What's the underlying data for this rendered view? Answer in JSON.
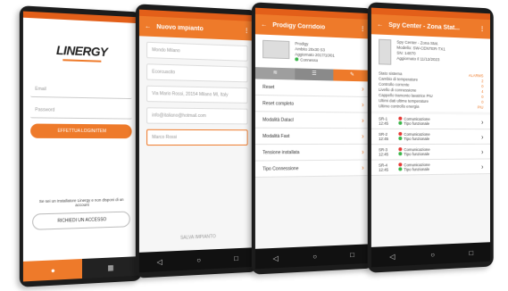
{
  "colors": {
    "accent": "#ee7a2a",
    "status_dark": "#e35f19",
    "nav": "#111111"
  },
  "login": {
    "logo": "LINERGY",
    "email_placeholder": "Email",
    "password_placeholder": "Password",
    "login_button": "EFFETTUA LOGIN/ITEM",
    "register_text": "Se sei un installatore Linergy e non disponi di un account",
    "register_button": "RICHIEDI UN ACCESSO",
    "tab_left_icon": "user-icon",
    "tab_right_icon": "building-icon"
  },
  "edit": {
    "title": "Nuovo impianto",
    "fields": [
      "Mondo Milano",
      "Ecorcuscito",
      "Via Mario Rossi, 20154 Milano MI, Italy",
      "info@italiano@hotmail.com",
      "Marco Rossi"
    ],
    "save_button": "SALVA IMPIANTO"
  },
  "corridor": {
    "title": "Prodigy Corridoio",
    "device_lines": [
      "Prodigy",
      "Ambito 20x30 S3",
      "Aggiornato 2017/10/01"
    ],
    "status_label": "Connesso",
    "tabs": [
      "wifi-icon",
      "sliders-icon",
      "wrench-icon"
    ],
    "rows": [
      "Reset",
      "Reset completo",
      "Modalità Datacl",
      "Modalità Fast",
      "Tensione installata",
      "Tipo Connessione"
    ]
  },
  "spy": {
    "title": "Spy Center - Zona Stat...",
    "device_lines": [
      "Spy Center - Zona Stat.",
      "Modello: SW-CENTER-TX1",
      "SN: 14870",
      "Aggiornato il 11/12/2023"
    ],
    "info_rows": [
      {
        "label": "Stato sistema",
        "value": "ALARMS"
      },
      {
        "label": "Cambio di temperature",
        "value": "2"
      },
      {
        "label": "Controllo corrente",
        "value": "0"
      },
      {
        "label": "Livello di connessione",
        "value": "4"
      },
      {
        "label": "Cappello tramonto lavatrice PIU",
        "value": "0"
      },
      {
        "label": "Ultimi dati ultime temperature",
        "value": "0"
      },
      {
        "label": "Ultimo controllo energia",
        "value": "PIU"
      }
    ],
    "zones": [
      {
        "name": "SR-1",
        "time": "12:45",
        "a": "Comunicazione",
        "b": "Tipo funzionale"
      },
      {
        "name": "SR-2",
        "time": "12:45",
        "a": "Comunicazione",
        "b": "Tipo funzionale"
      },
      {
        "name": "SR-3",
        "time": "12:45",
        "a": "Comunicazione",
        "b": "Tipo funzionale"
      },
      {
        "name": "SR-4",
        "time": "12:45",
        "a": "Comunicazione",
        "b": "Tipo funzionale"
      }
    ]
  }
}
